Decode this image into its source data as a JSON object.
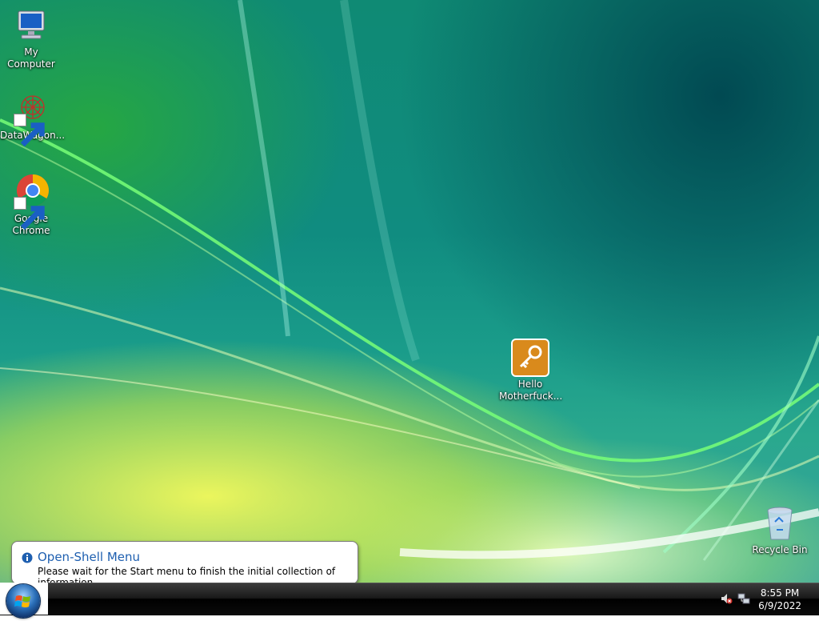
{
  "desktop": {
    "icons": [
      {
        "label": "My Computer",
        "icon": "my-computer-icon"
      },
      {
        "label": "DataWagon...",
        "icon": "datawagon-icon"
      },
      {
        "label": "Google Chrome",
        "icon": "chrome-icon"
      },
      {
        "label": "Hello Motherfuck...",
        "icon": "key-icon"
      },
      {
        "label": "Recycle Bin",
        "icon": "recycle-bin-icon"
      }
    ]
  },
  "notification": {
    "title": "Open-Shell Menu",
    "message": "Please wait for the Start menu to finish the initial collection of information",
    "icon": "info-icon"
  },
  "taskbar": {
    "start_icon": "windows-orb-icon",
    "clock": {
      "time": "8:55 PM",
      "date": "6/9/2022"
    },
    "tray_icons": [
      "volume-muted-icon",
      "network-icon"
    ]
  },
  "colors": {
    "accent": "#1e5fb0",
    "taskbar": "#000000"
  }
}
